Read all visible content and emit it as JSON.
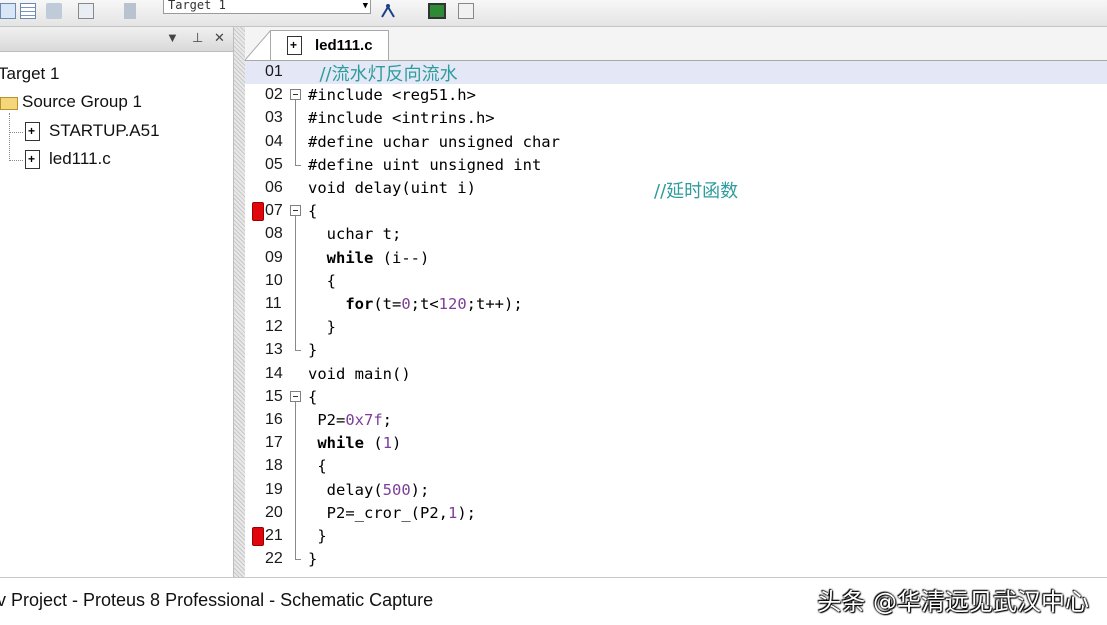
{
  "toolbar": {
    "target_select": "Target 1"
  },
  "project_panel": {
    "pin_glyph": "▾ ⊥ ✕",
    "tree": {
      "target": "Target 1",
      "group": "Source Group 1",
      "files": [
        "STARTUP.A51",
        "led111.c"
      ]
    }
  },
  "editor": {
    "tab_label": "led111.c",
    "lines": [
      {
        "num": "01",
        "text": "  //流水灯反向流水"
      },
      {
        "num": "02",
        "text": "#include <reg51.h>"
      },
      {
        "num": "03",
        "text": "#include <intrins.h>"
      },
      {
        "num": "04",
        "text": "#define uchar unsigned char"
      },
      {
        "num": "05",
        "text": "#define uint unsigned int"
      },
      {
        "num": "06",
        "text": "void delay(uint i)"
      },
      {
        "num": "07",
        "text": "{"
      },
      {
        "num": "08",
        "text": "  uchar t;"
      },
      {
        "num": "09",
        "text": "  while (i--)"
      },
      {
        "num": "10",
        "text": "  {"
      },
      {
        "num": "11",
        "text": "    for(t=0;t<120;t++);"
      },
      {
        "num": "12",
        "text": "  }"
      },
      {
        "num": "13",
        "text": "}"
      },
      {
        "num": "14",
        "text": "void main()"
      },
      {
        "num": "15",
        "text": "{"
      },
      {
        "num": "16",
        "text": " P2=0x7f;"
      },
      {
        "num": "17",
        "text": " while (1)"
      },
      {
        "num": "18",
        "text": " {"
      },
      {
        "num": "19",
        "text": "  delay(500);"
      },
      {
        "num": "20",
        "text": "  P2=_cror_(P2,1);"
      },
      {
        "num": "21",
        "text": " }"
      },
      {
        "num": "22",
        "text": "}"
      }
    ],
    "comment_06": "//延时函数",
    "breakpoint_lines": [
      "07",
      "21"
    ],
    "highlighted_line": "01"
  },
  "statusbar": {
    "text": "v Project - Proteus 8 Professional - Schematic Capture",
    "watermark": "头条 @华清远见武汉中心"
  },
  "colors": {
    "keyword": "#000000",
    "number": "#7e3e98",
    "comment": "#2e9c9c",
    "breakpoint": "#e0060b",
    "current_line": "#e4e8f6"
  },
  "icons": [
    "toolbar-icons",
    "file-icon",
    "folder-icon",
    "breakpoint-icon",
    "fold-box-icon"
  ]
}
